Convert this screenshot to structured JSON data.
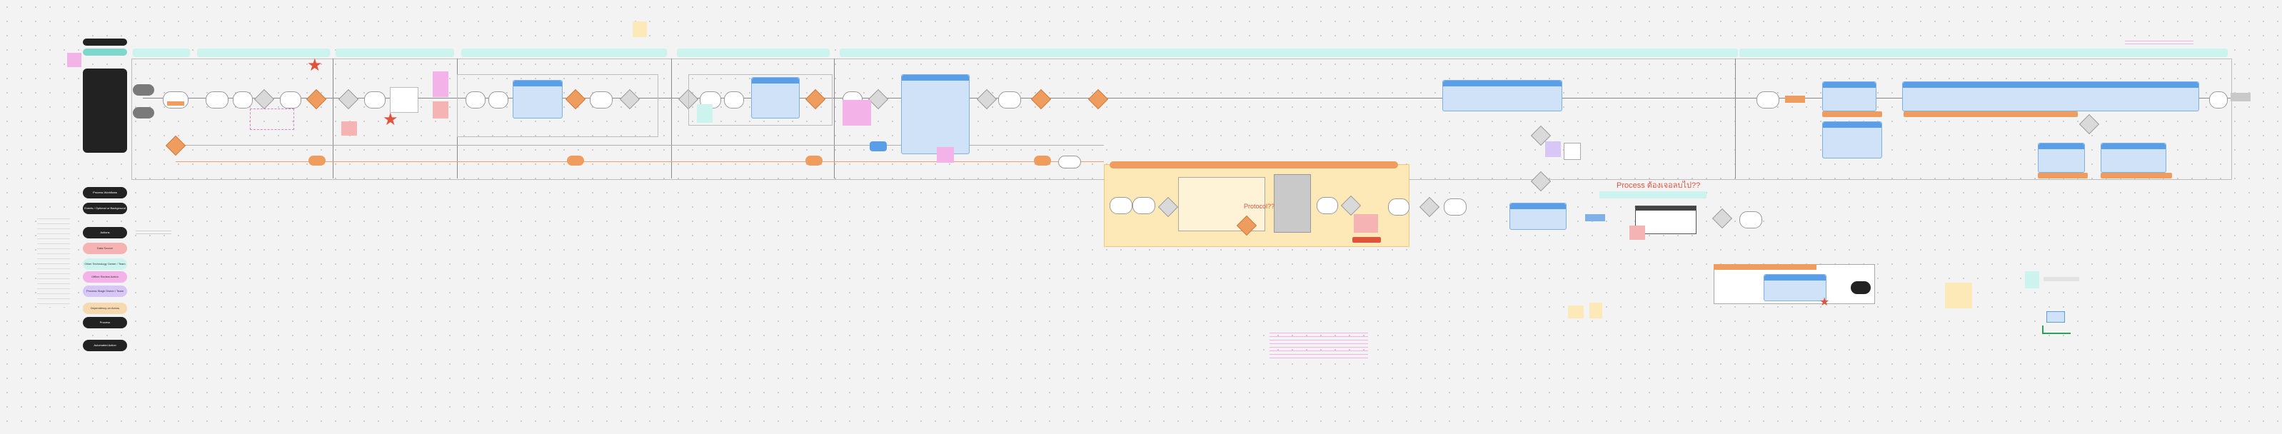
{
  "legend": {
    "items": [
      {
        "label": "Process Workflows",
        "color": "#222222"
      },
      {
        "label": "Events / Optional or Background",
        "color": "#222222"
      },
      {
        "label": "Actions",
        "color": "#222222"
      },
      {
        "label": "Data Source",
        "color": "#f6b3b3"
      },
      {
        "label": "Other Technology Owner / Team",
        "color": "#cdf3ee"
      },
      {
        "label": "Offline Review Action",
        "color": "#f3b3e8"
      },
      {
        "label": "Process Stage Owner / Team",
        "color": "#d7c6f6"
      },
      {
        "label": "Dependency on Actors",
        "color": "#f7d9b0"
      },
      {
        "label": "Process",
        "color": "#222222"
      },
      {
        "label": "Automated Action",
        "color": "#222222"
      }
    ]
  },
  "process_labels": {
    "protocol": "Protocol??",
    "process_question": "Process ต้องเจอลบไป??"
  },
  "colors": {
    "phase": "#cdf3ee",
    "orange": "#ee9d5f",
    "blue": "#5b9ee8",
    "star": "#e0533d",
    "pink": "#f3b3e8",
    "salmon": "#f6b3b3",
    "yellow_area": "#fde9b8"
  }
}
